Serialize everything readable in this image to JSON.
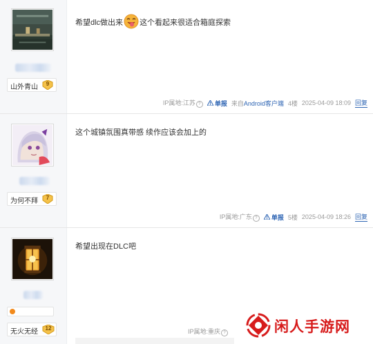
{
  "posts": [
    {
      "username": "山外青山",
      "level": "9",
      "text_before": "希望dlc做出来",
      "text_after": "这个看起来很适合箱庭探索",
      "ip": "IP属地:江苏",
      "report": "单报",
      "client_prefix": "来自",
      "client_name": "Android客户端",
      "floor": "4楼",
      "time": "2025-04-09 18:09",
      "reply": "回复"
    },
    {
      "username": "为何不拜",
      "level": "7",
      "text": "这个城镇氛围真带感 续作应该会加上的",
      "ip": "IP属地:广东",
      "report": "单报",
      "floor": "5楼",
      "time": "2025-04-09 18:26",
      "reply": "回复"
    },
    {
      "username": "无火无经",
      "level": "12",
      "text": "希望出现在DLC吧",
      "ip": "IP属地:重庆"
    }
  ],
  "watermark": {
    "text": "闲人手游网"
  },
  "colors": {
    "sidebar": "#f6f7f9",
    "link": "#2d64b3",
    "meta": "#999999",
    "watermark": "#d71c1c",
    "level_badge": "#f5c24a"
  }
}
